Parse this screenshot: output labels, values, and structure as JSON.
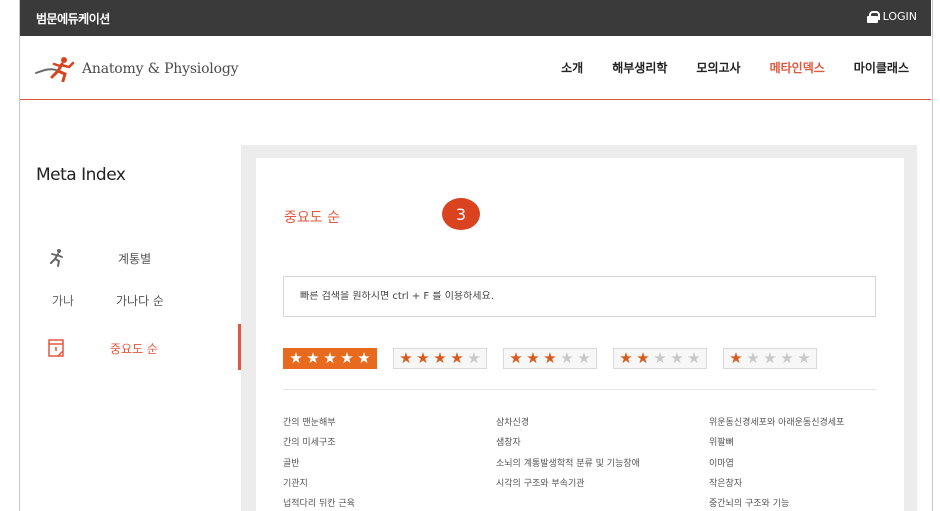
{
  "topbar": {
    "brand": "범문에듀케이션",
    "login": "LOGIN"
  },
  "logo": {
    "text": "Anatomy & Physiology"
  },
  "nav": {
    "items": [
      {
        "label": "소개",
        "active": false
      },
      {
        "label": "해부생리학",
        "active": false
      },
      {
        "label": "모의고사",
        "active": false
      },
      {
        "label": "메타인덱스",
        "active": true
      },
      {
        "label": "마이클래스",
        "active": false
      }
    ]
  },
  "sidebar": {
    "title": "Meta Index",
    "items": [
      {
        "icon": "runner-icon",
        "icon_text": "",
        "label": "계통별"
      },
      {
        "icon": "hangul-icon",
        "icon_text": "가나",
        "label": "가나다 순"
      },
      {
        "icon": "document-icon",
        "icon_text": "",
        "label": "중요도 순"
      }
    ]
  },
  "main": {
    "title": "중요도 순",
    "badge": "3",
    "search": {
      "placeholder": "빠른 검색을 원하시면 ctrl + F 를 이용하세요."
    },
    "star_filters": [
      5,
      4,
      3,
      2,
      1
    ],
    "columns": [
      [
        "간의 맨눈해부",
        "간의 미세구조",
        "골반",
        "기관지",
        "넙적다리 뒤칸 근육"
      ],
      [
        "삼차신경",
        "샘창자",
        "소뇌의 계통발생학적 분류 및 기능장애",
        "시각의 구조와 부속기관"
      ],
      [
        "위운동신경세포와 아래운동신경세포",
        "위팔뼈",
        "이마엽",
        "작은창자",
        "중간뇌의 구조와 기능"
      ]
    ]
  },
  "colors": {
    "accent": "#e2583e",
    "star_active": "#e86a1f",
    "topbar": "#3a3a3a"
  }
}
